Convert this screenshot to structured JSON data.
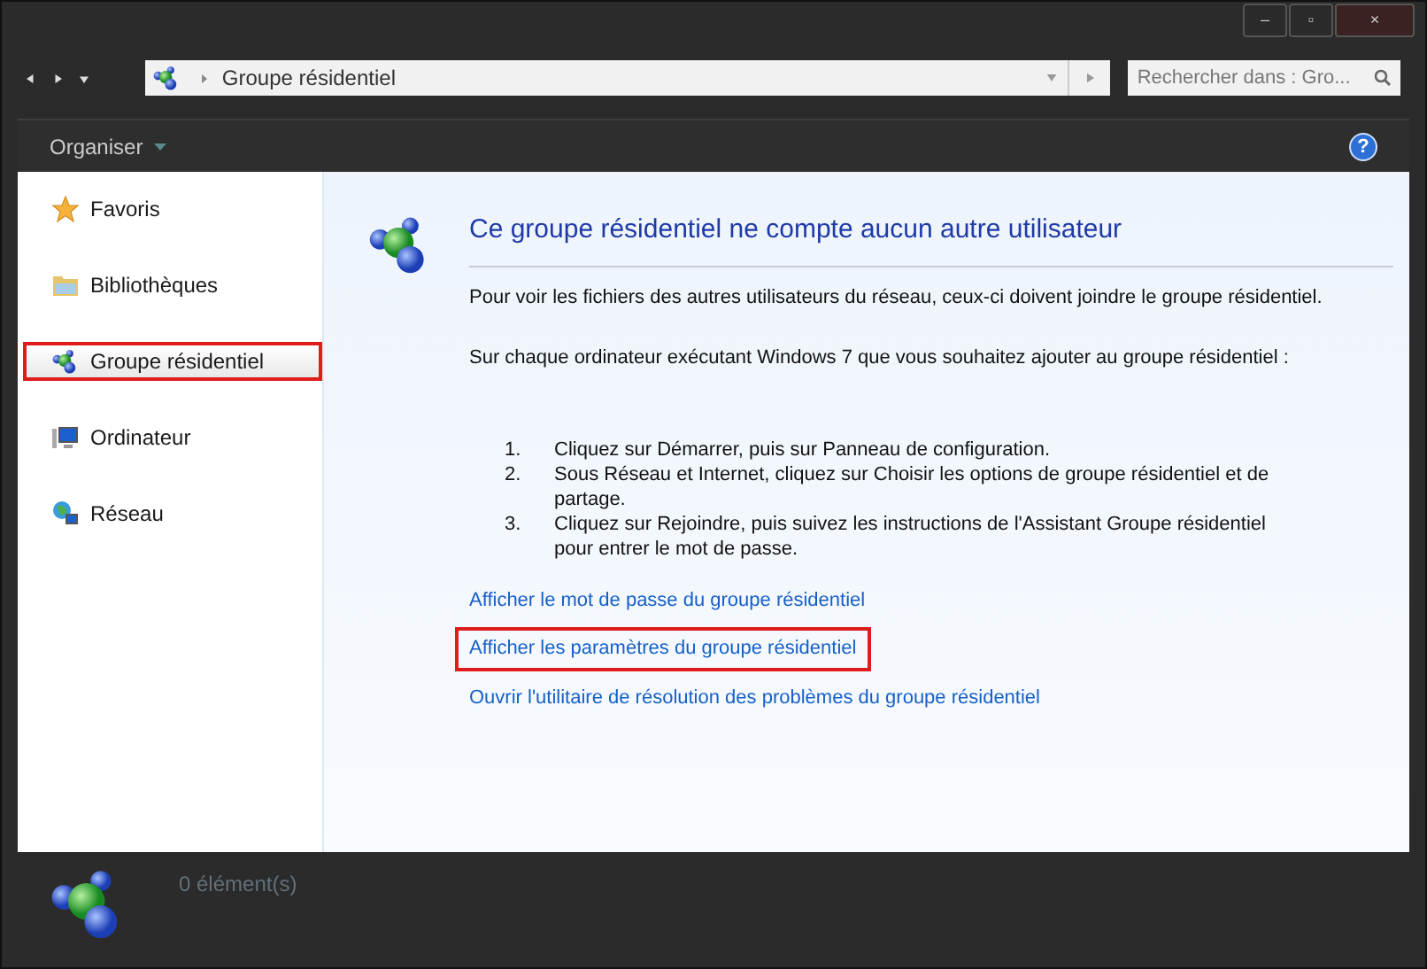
{
  "window_controls": [
    "–",
    "▫",
    "×"
  ],
  "address_bar": {
    "location": "Groupe résidentiel"
  },
  "search": {
    "placeholder": "Rechercher dans : Gro..."
  },
  "toolbar": {
    "organize": "Organiser",
    "help": "?"
  },
  "sidebar": {
    "items": [
      {
        "label": "Favoris",
        "kind": "star",
        "highlighted": false
      },
      {
        "label": "Bibliothèques",
        "kind": "folder",
        "highlighted": false
      },
      {
        "label": "Groupe résidentiel",
        "kind": "homegroup",
        "highlighted": true
      },
      {
        "label": "Ordinateur",
        "kind": "computer",
        "highlighted": false
      },
      {
        "label": "Réseau",
        "kind": "network",
        "highlighted": false
      }
    ]
  },
  "content": {
    "heading": "Ce groupe résidentiel ne compte aucun autre utilisateur",
    "paragraphs": [
      "Pour voir les fichiers des autres utilisateurs du réseau, ceux-ci doivent joindre le groupe résidentiel.",
      "Sur chaque ordinateur exécutant Windows 7 que vous souhaitez ajouter au groupe résidentiel :"
    ],
    "steps": [
      {
        "number": "1.",
        "text": "Cliquez sur Démarrer, puis sur Panneau de configuration."
      },
      {
        "number": "2.",
        "text": "Sous Réseau et Internet, cliquez sur Choisir les options de groupe résidentiel et de partage."
      },
      {
        "number": "3.",
        "text": "Cliquez sur Rejoindre, puis suivez les instructions de l'Assistant Groupe résidentiel pour entrer le mot de passe."
      }
    ],
    "links": [
      {
        "label": "Afficher le mot de passe du groupe résidentiel",
        "highlighted": false
      },
      {
        "label": "Afficher les paramètres du groupe résidentiel",
        "highlighted": true
      },
      {
        "label": "Ouvrir l'utilitaire de résolution des problèmes du groupe résidentiel",
        "highlighted": false
      }
    ]
  },
  "status_bar": {
    "count": "0 élément(s)"
  }
}
